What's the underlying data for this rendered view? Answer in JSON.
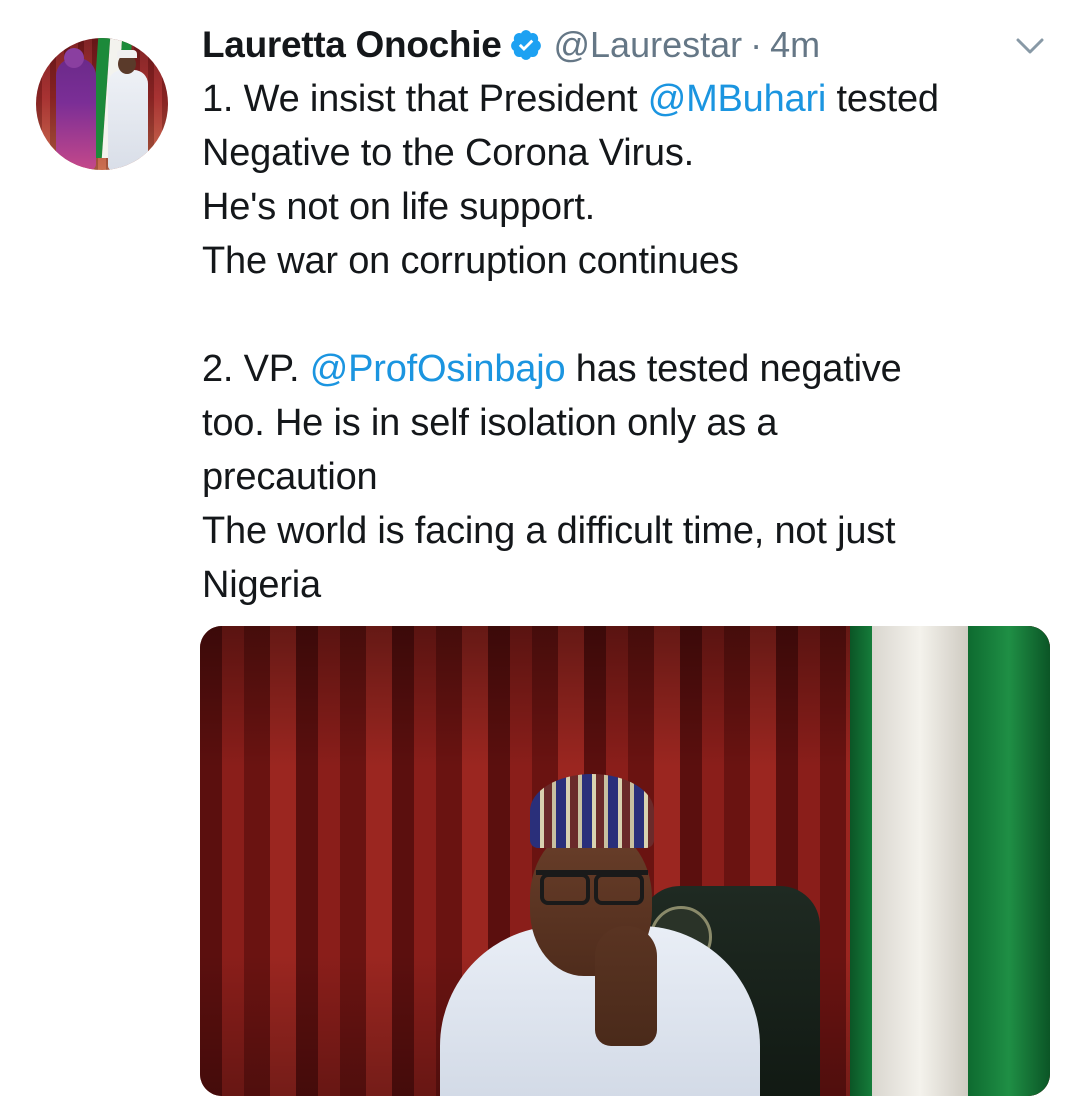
{
  "tweet": {
    "author": {
      "display_name": "Lauretta Onochie",
      "handle": "@Laurestar",
      "verified": true
    },
    "separator": "·",
    "timestamp": "4m",
    "lines": [
      {
        "parts": [
          {
            "text": "1. We insist that President "
          },
          {
            "text": "@MBuhari",
            "mention": true
          },
          {
            "text": " tested"
          }
        ]
      },
      {
        "parts": [
          {
            "text": "Negative to the Corona Virus."
          }
        ]
      },
      {
        "parts": [
          {
            "text": "He's not on life support."
          }
        ]
      },
      {
        "parts": [
          {
            "text": "The war on corruption continues"
          }
        ]
      },
      {
        "parts": []
      },
      {
        "parts": [
          {
            "text": "2. VP. "
          },
          {
            "text": "@ProfOsinbajo",
            "mention": true
          },
          {
            "text": " has tested negative"
          }
        ]
      },
      {
        "parts": [
          {
            "text": "too. He is in self isolation only as a"
          }
        ]
      },
      {
        "parts": [
          {
            "text": "precaution"
          }
        ]
      },
      {
        "parts": [
          {
            "text": "The world is facing a difficult time, not just"
          }
        ]
      },
      {
        "parts": [
          {
            "text": "Nigeria"
          }
        ]
      }
    ]
  },
  "icons": {
    "verified": "verified-badge-icon",
    "menu": "chevron-down-icon"
  },
  "colors": {
    "text": "#14171a",
    "secondary": "#657786",
    "mention": "#1b95e0",
    "verified": "#1da1f2"
  }
}
